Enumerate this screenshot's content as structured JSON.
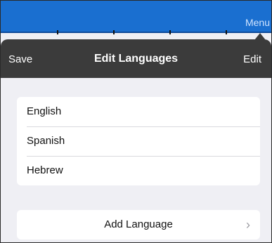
{
  "app_bar": {
    "menu_label": "Menu"
  },
  "nav": {
    "save_label": "Save",
    "title": "Edit Languages",
    "edit_label": "Edit"
  },
  "languages": [
    {
      "label": "English"
    },
    {
      "label": "Spanish"
    },
    {
      "label": "Hebrew"
    }
  ],
  "add_language": {
    "label": "Add Language",
    "chevron": "chevron-right-icon"
  },
  "colors": {
    "app_bar": "#1a6fd0",
    "nav_bar": "#3b3b3b",
    "background": "#efeff4"
  }
}
